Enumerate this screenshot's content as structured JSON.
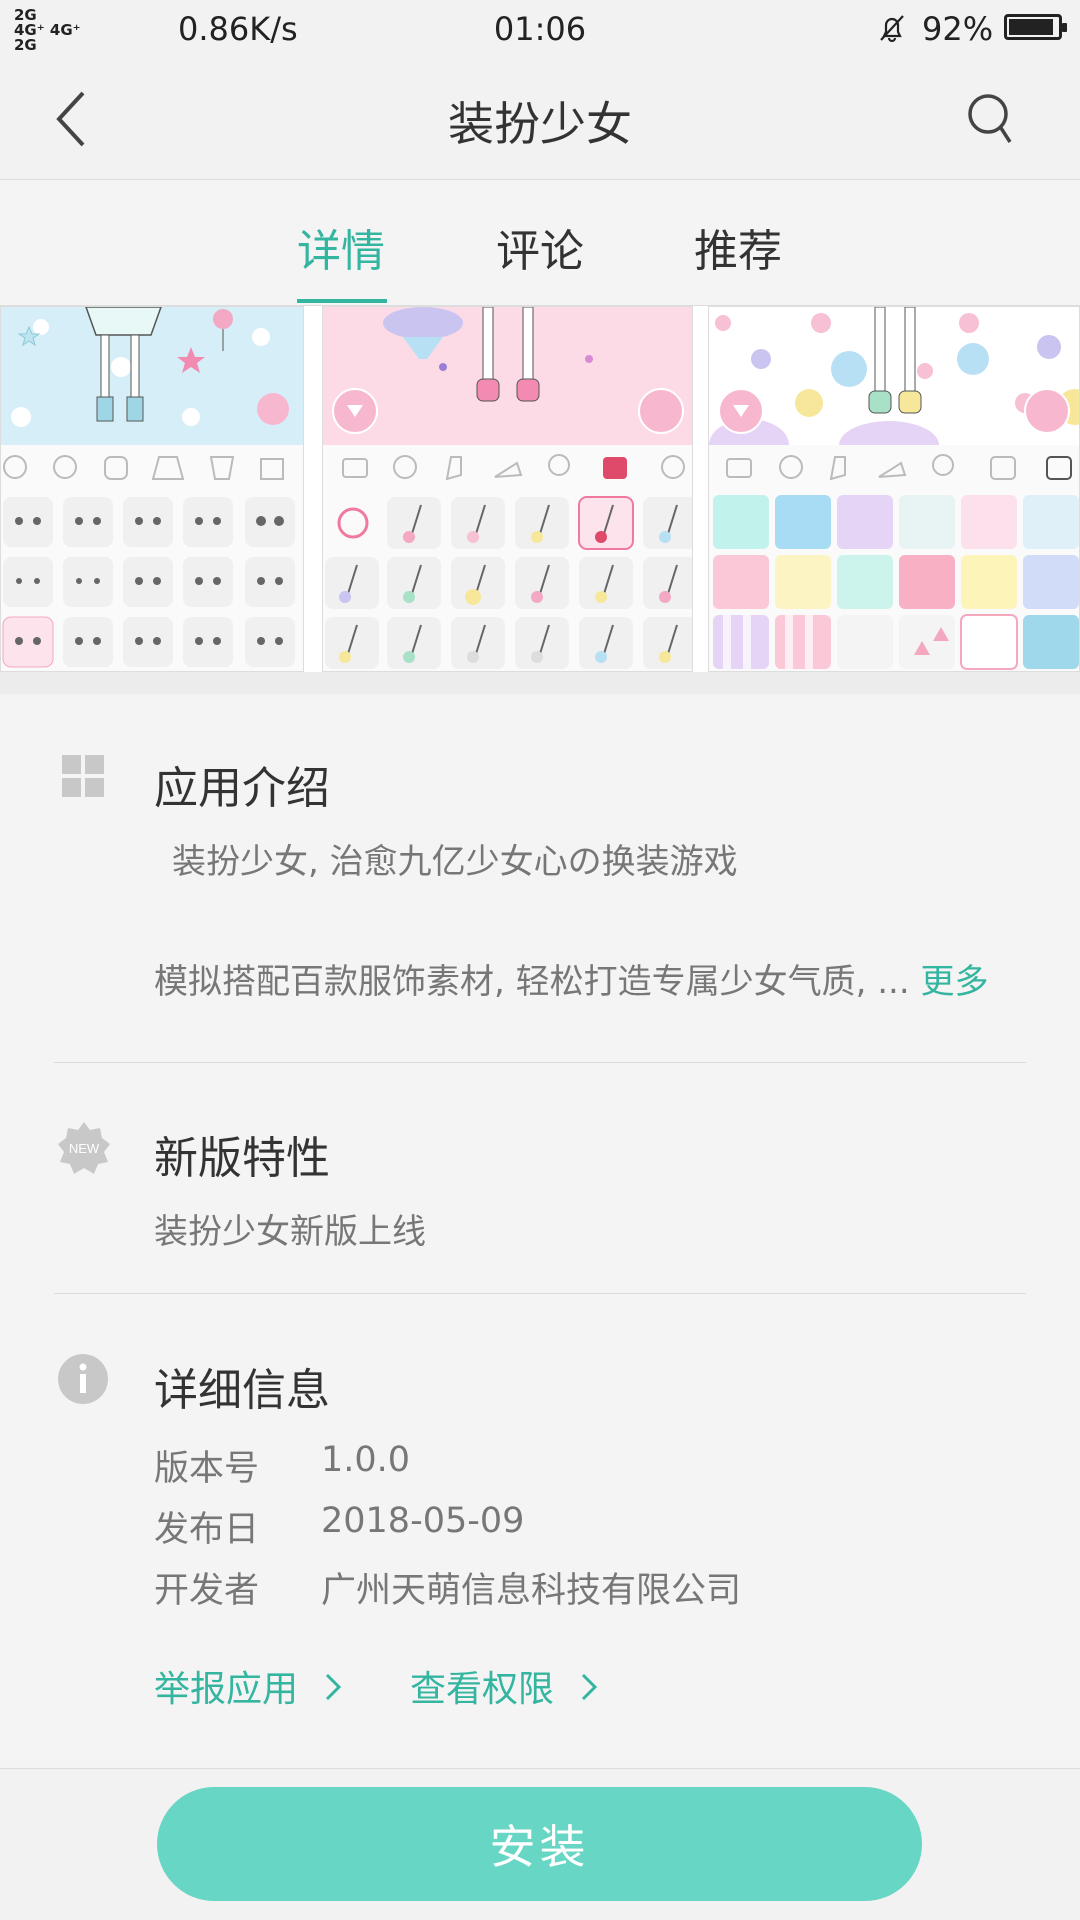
{
  "status_bar": {
    "signal_1": "2G",
    "signal_2": "4G⁺ 4G⁺",
    "signal_3": "2G",
    "net_speed": "0.86K/s",
    "time": "01:06",
    "battery": "92%",
    "battery_level": 0.92,
    "icons": [
      "signal-icon",
      "bell-muted-icon",
      "battery-icon"
    ]
  },
  "header": {
    "title": "装扮少女",
    "back_icon": "chevron-left-icon",
    "search_icon": "search-icon"
  },
  "tabs": [
    {
      "label": "详情",
      "active": true
    },
    {
      "label": "评论",
      "active": false
    },
    {
      "label": "推荐",
      "active": false
    }
  ],
  "intro": {
    "title": "应用介绍",
    "line1": "装扮少女, 治愈九亿少女心の换装游戏",
    "line2": "模拟搭配百款服饰素材, 轻松打造专属少女气质, ...",
    "more": "更多",
    "icon": "grid-icon"
  },
  "new_features": {
    "title": "新版特性",
    "badge": "NEW",
    "text": "装扮少女新版上线",
    "icon": "new-badge-icon"
  },
  "details": {
    "title": "详细信息",
    "icon": "info-icon",
    "rows": [
      {
        "label": "版本号",
        "value": "1.0.0"
      },
      {
        "label": "发布日",
        "value": "2018-05-09"
      },
      {
        "label": "开发者",
        "value": "广州天萌信息科技有限公司"
      }
    ],
    "report_link": "举报应用",
    "permission_link": "查看权限"
  },
  "install_button": "安装",
  "colors": {
    "accent": "#33b5a0",
    "install": "#68d6c5"
  }
}
